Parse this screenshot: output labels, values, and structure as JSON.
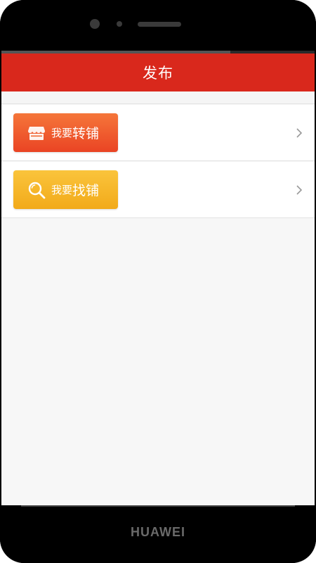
{
  "header": {
    "title": "发布"
  },
  "menu": {
    "items": [
      {
        "label_prefix": "我要",
        "label_main": "转铺",
        "icon": "shop-icon",
        "color_top": "#f5763a",
        "color_bottom": "#ea4424"
      },
      {
        "label_prefix": "我要",
        "label_main": "找铺",
        "icon": "search-icon",
        "color_top": "#fac43c",
        "color_bottom": "#f2aa1a"
      }
    ]
  },
  "device": {
    "brand": "HUAWEI"
  },
  "colors": {
    "titlebar": "#d9281c",
    "background": "#f7f7f7"
  }
}
